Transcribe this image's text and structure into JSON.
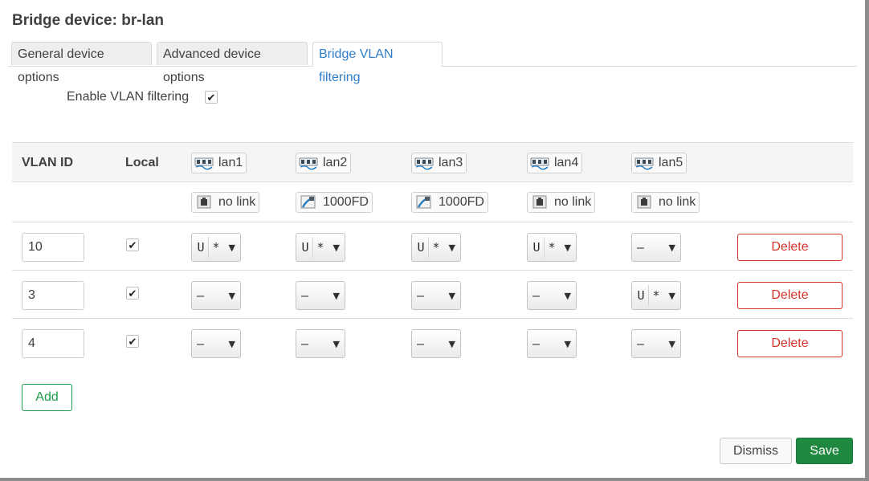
{
  "dialog": {
    "title": "Bridge device: br-lan"
  },
  "tabs": [
    {
      "label": "General device options",
      "active": false
    },
    {
      "label": "Advanced device options",
      "active": false
    },
    {
      "label": "Bridge VLAN filtering",
      "active": true
    }
  ],
  "enable_vlan": {
    "label": "Enable VLAN filtering",
    "checked": true,
    "check_glyph": "✔"
  },
  "table": {
    "headers": {
      "vlan_id": "VLAN ID",
      "local": "Local"
    },
    "ports": [
      {
        "name": "lan1",
        "icon": "ethernet-ports-icon",
        "status": "no link",
        "status_icon": "port-disconnected-icon"
      },
      {
        "name": "lan2",
        "icon": "ethernet-ports-icon",
        "status": "1000FD",
        "status_icon": "port-connected-icon"
      },
      {
        "name": "lan3",
        "icon": "ethernet-ports-icon",
        "status": "1000FD",
        "status_icon": "port-connected-icon"
      },
      {
        "name": "lan4",
        "icon": "ethernet-ports-icon",
        "status": "no link",
        "status_icon": "port-disconnected-icon"
      },
      {
        "name": "lan5",
        "icon": "ethernet-ports-icon",
        "status": "no link",
        "status_icon": "port-disconnected-icon"
      }
    ],
    "rows": [
      {
        "vlan_id": "10",
        "local": true,
        "ports": [
          {
            "mode": "U",
            "pvid": "*",
            "none": ""
          },
          {
            "mode": "U",
            "pvid": "*",
            "none": ""
          },
          {
            "mode": "U",
            "pvid": "*",
            "none": ""
          },
          {
            "mode": "U",
            "pvid": "*",
            "none": ""
          },
          {
            "mode": "",
            "pvid": "",
            "none": "–"
          }
        ],
        "delete_label": "Delete"
      },
      {
        "vlan_id": "3",
        "local": true,
        "ports": [
          {
            "mode": "",
            "pvid": "",
            "none": "–"
          },
          {
            "mode": "",
            "pvid": "",
            "none": "–"
          },
          {
            "mode": "",
            "pvid": "",
            "none": "–"
          },
          {
            "mode": "",
            "pvid": "",
            "none": "–"
          },
          {
            "mode": "U",
            "pvid": "*",
            "none": ""
          }
        ],
        "delete_label": "Delete"
      },
      {
        "vlan_id": "4",
        "local": true,
        "ports": [
          {
            "mode": "",
            "pvid": "",
            "none": "–"
          },
          {
            "mode": "",
            "pvid": "",
            "none": "–"
          },
          {
            "mode": "",
            "pvid": "",
            "none": "–"
          },
          {
            "mode": "",
            "pvid": "",
            "none": "–"
          },
          {
            "mode": "",
            "pvid": "",
            "none": "–"
          }
        ],
        "delete_label": "Delete"
      }
    ]
  },
  "buttons": {
    "add": "Add",
    "dismiss": "Dismiss",
    "save": "Save"
  },
  "colors": {
    "accent": "#2f7dc8",
    "danger": "#d3342a",
    "positive": "#1e9c4e",
    "save_bg": "#1f8a3f"
  }
}
